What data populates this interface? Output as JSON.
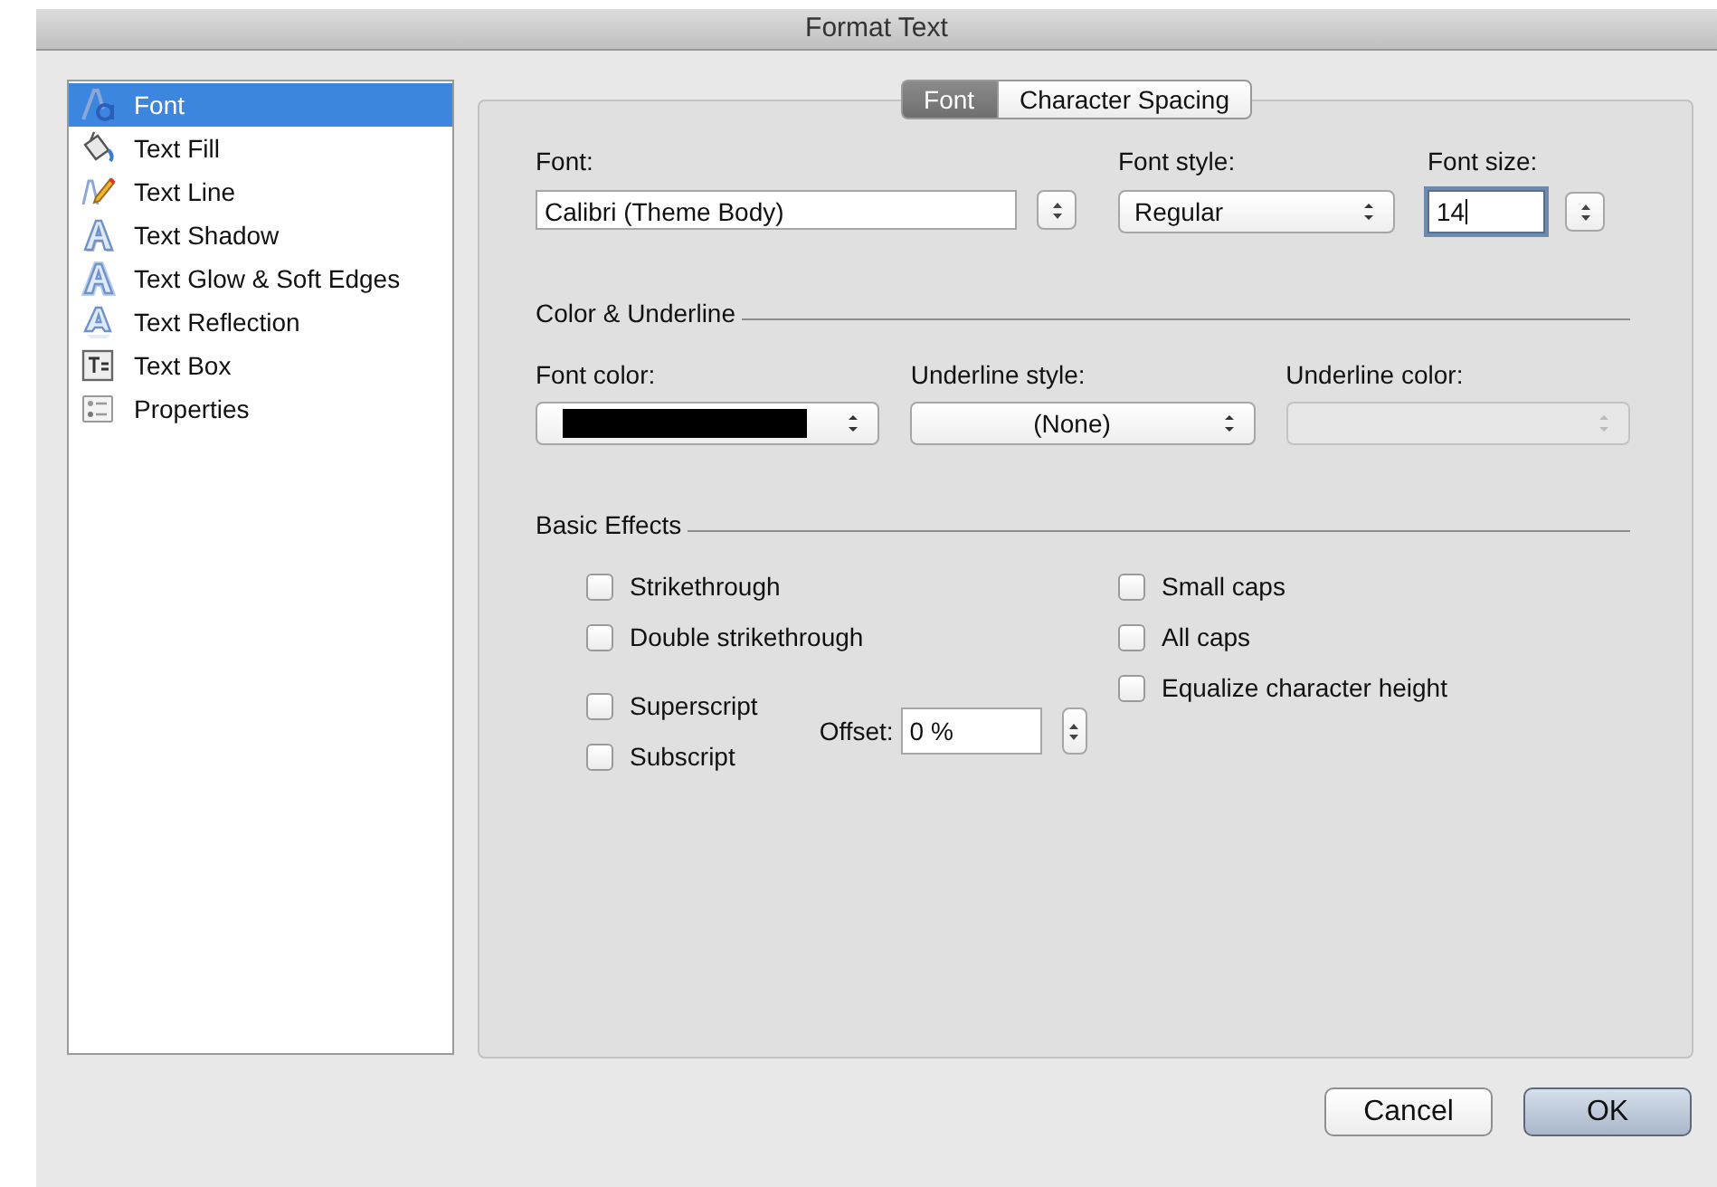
{
  "window": {
    "title": "Format Text"
  },
  "sidebar": {
    "items": [
      {
        "label": "Font",
        "selected": true
      },
      {
        "label": "Text Fill",
        "selected": false
      },
      {
        "label": "Text Line",
        "selected": false
      },
      {
        "label": "Text Shadow",
        "selected": false
      },
      {
        "label": "Text Glow & Soft Edges",
        "selected": false
      },
      {
        "label": "Text Reflection",
        "selected": false
      },
      {
        "label": "Text Box",
        "selected": false
      },
      {
        "label": "Properties",
        "selected": false
      }
    ]
  },
  "tabs": [
    {
      "label": "Font",
      "selected": true
    },
    {
      "label": "Character Spacing",
      "selected": false
    }
  ],
  "font_section": {
    "font": {
      "label": "Font:",
      "value": "Calibri (Theme Body)"
    },
    "font_style": {
      "label": "Font style:",
      "value": "Regular"
    },
    "font_size": {
      "label": "Font size:",
      "value": "14",
      "focused": true
    }
  },
  "color_underline": {
    "title": "Color & Underline",
    "font_color": {
      "label": "Font color:",
      "color": "#000000"
    },
    "underline_style": {
      "label": "Underline style:",
      "value": "(None)"
    },
    "underline_color": {
      "label": "Underline color:",
      "disabled": true
    }
  },
  "basic_effects": {
    "title": "Basic Effects",
    "left_checkboxes": [
      {
        "label": "Strikethrough",
        "checked": false
      },
      {
        "label": "Double strikethrough",
        "checked": false
      },
      {
        "label": "Superscript",
        "checked": false
      },
      {
        "label": "Subscript",
        "checked": false
      }
    ],
    "right_checkboxes": [
      {
        "label": "Small caps",
        "checked": false
      },
      {
        "label": "All caps",
        "checked": false
      },
      {
        "label": "Equalize character height",
        "checked": false
      }
    ],
    "offset": {
      "label": "Offset:",
      "value": "0 %"
    }
  },
  "buttons": [
    {
      "label": "Cancel",
      "default": false
    },
    {
      "label": "OK",
      "default": true
    }
  ]
}
